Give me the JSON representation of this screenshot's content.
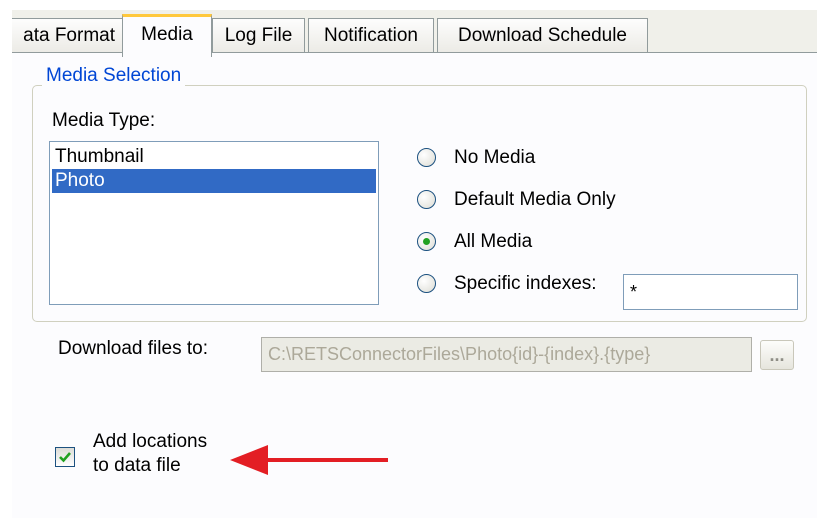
{
  "tabs": [
    {
      "label": "ata Format",
      "active": false
    },
    {
      "label": "Media",
      "active": true
    },
    {
      "label": "Log File",
      "active": false
    },
    {
      "label": "Notification",
      "active": false
    },
    {
      "label": "Download Schedule",
      "active": false
    }
  ],
  "media_selection": {
    "legend": "Media Selection",
    "media_type_label": "Media Type:",
    "media_types": [
      {
        "label": "Thumbnail",
        "selected": false
      },
      {
        "label": "Photo",
        "selected": true
      }
    ],
    "options": [
      {
        "label": "No Media",
        "checked": false
      },
      {
        "label": "Default Media Only",
        "checked": false
      },
      {
        "label": "All Media",
        "checked": true
      },
      {
        "label": "Specific indexes:",
        "checked": false
      }
    ],
    "specific_indexes_value": "*"
  },
  "download": {
    "label": "Download files to:",
    "path_value": "C:\\RETSConnectorFiles\\Photo{id}-{index}.{type}",
    "browse_label": "..."
  },
  "add_locations": {
    "label": "Add locations\nto data file",
    "checked": true
  },
  "colors": {
    "legend": "#0046d5",
    "selection": "#316ac5",
    "active_tab_accent": "#ffc83c",
    "radio_dot": "#21a121",
    "check_mark": "#21a121",
    "annotation_arrow": "#e31e24"
  },
  "icons": {
    "annotation": "red-arrow-left-icon",
    "check": "checkmark-icon"
  }
}
